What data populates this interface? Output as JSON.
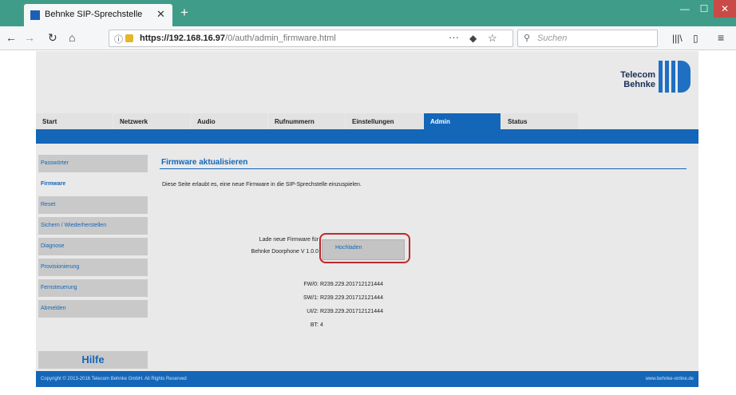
{
  "browser": {
    "tab_title": "Behnke SIP-Sprechstelle",
    "url_host": "https://192.168.16.97",
    "url_path": "/0/auth/admin_firmware.html",
    "search_placeholder": "Suchen"
  },
  "brand": {
    "line1": "Telecom",
    "line2": "Behnke",
    "color": "#1466b8"
  },
  "menu": [
    "Start",
    "Netzwerk",
    "Audio",
    "Rufnummern",
    "Einstellungen",
    "Admin",
    "Status"
  ],
  "sidebar": [
    {
      "label": "Passwörter"
    },
    {
      "label": "Firmware"
    },
    {
      "label": "Reset"
    },
    {
      "label": "Sichern / Wiederherstellen"
    },
    {
      "label": "Diagnose"
    },
    {
      "label": "Provisionierung"
    },
    {
      "label": "Fernsteuerung"
    },
    {
      "label": "Abmelden"
    }
  ],
  "help": "Hilfe",
  "main": {
    "title": "Firmware aktualisieren",
    "description": "Diese Seite erlaubt es, eine neue Firmware in die SIP-Sprechstelle einzuspielen.",
    "upload_label_1": "Lade neue Firmware für",
    "upload_label_2": "Behnke Doorphone V 1.0.0",
    "upload_button": "Hochladen",
    "fw_rows": [
      {
        "label": "FW/0:",
        "value": "R239.229.201712121444"
      },
      {
        "label": "SW/1:",
        "value": "R239.229.201712121444"
      },
      {
        "label": "UI/2:",
        "value": "R239.229.201712121444"
      },
      {
        "label": "BT:",
        "value": "4"
      }
    ]
  },
  "footer": {
    "copyright": "Copyright © 2013-2016 Telecom Behnke GmbH. All Rights Reserved",
    "link": "www.behnke-online.de"
  }
}
